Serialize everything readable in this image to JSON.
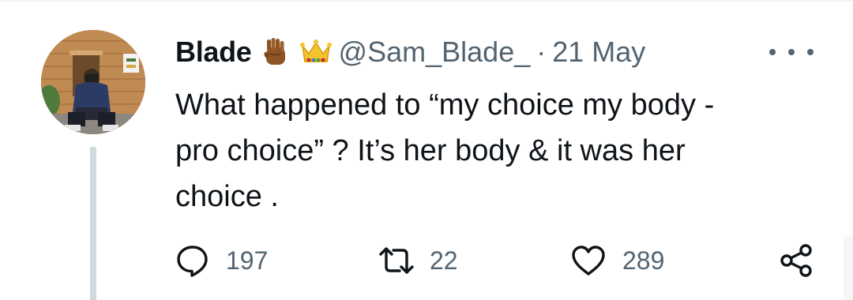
{
  "tweet": {
    "author": {
      "display_name": "Blade",
      "handle": "@Sam_Blade_",
      "badges": [
        "raised-fist-emoji",
        "crown-emoji"
      ]
    },
    "separator": "·",
    "date": "21 May",
    "text_lines": [
      "What happened to “my choice my body -",
      "pro choice” ? It’s her body & it was her",
      "choice ."
    ],
    "actions": {
      "replies": "197",
      "retweets": "22",
      "likes": "289"
    },
    "icons": {
      "reply": "comment-bubble-icon",
      "retweet": "retweet-icon",
      "like": "heart-icon",
      "share": "share-icon",
      "more": "more-options-icon"
    }
  },
  "colors": {
    "text_primary": "#0f1419",
    "text_secondary": "#536471",
    "thread_line": "#cfd9de"
  }
}
